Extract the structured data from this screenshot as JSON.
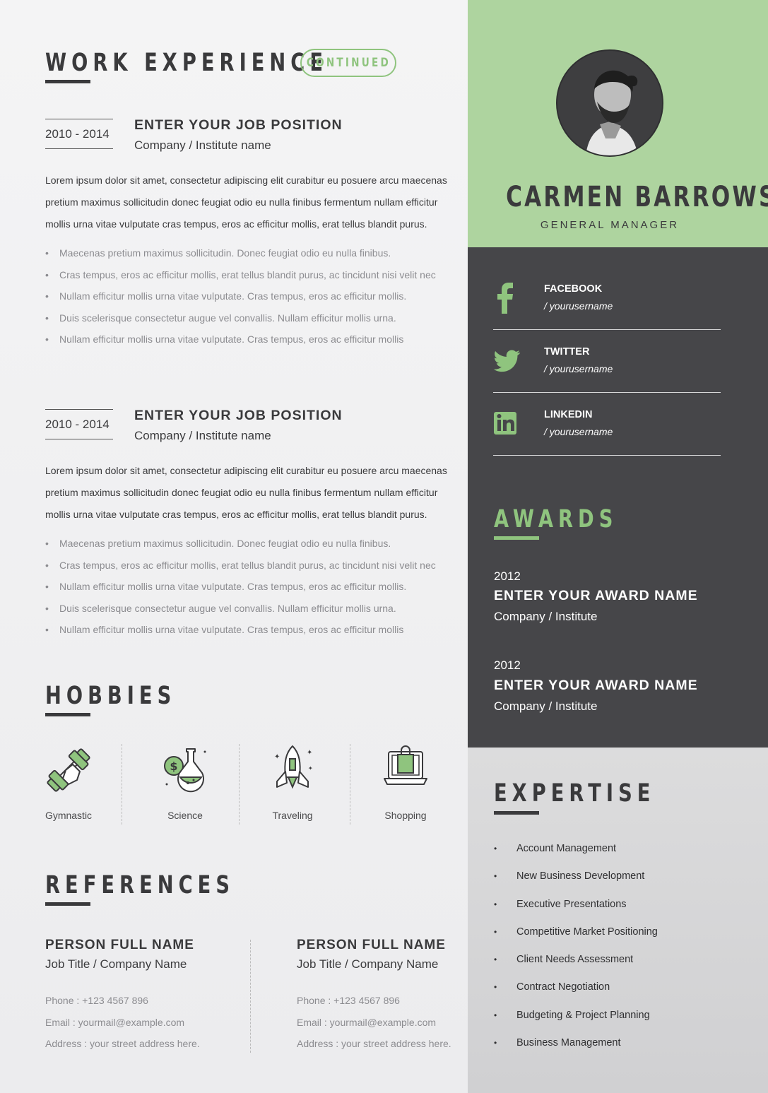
{
  "colors": {
    "accent": "#aed49f",
    "accent_text": "#8fc47e",
    "dark": "#464649",
    "light_panel": "#d6d6d8",
    "text": "#3a3a3c",
    "muted": "#8c8c90"
  },
  "work": {
    "title": "WORK EXPERIENCE",
    "badge": "CONTINUED",
    "jobs": [
      {
        "years": "2010 - 2014",
        "position": "ENTER YOUR JOB POSITION",
        "company": "Company / Institute name",
        "description": "Lorem ipsum dolor sit amet, consectetur adipiscing elit curabitur eu posuere arcu maecenas pretium maximus sollicitudin donec feugiat odio eu nulla finibus fermentum nullam efficitur mollis urna vitae vulputate cras tempus, eros ac efficitur mollis, erat tellus blandit purus.",
        "bullets": [
          "Maecenas pretium maximus sollicitudin. Donec feugiat odio eu nulla finibus.",
          "Cras tempus, eros ac efficitur mollis, erat tellus blandit purus, ac tincidunt nisi velit nec",
          "Nullam efficitur mollis urna vitae vulputate. Cras tempus, eros ac efficitur mollis.",
          "Duis scelerisque consectetur augue vel convallis.  Nullam efficitur mollis urna.",
          "Nullam efficitur mollis urna vitae vulputate. Cras tempus, eros ac efficitur mollis"
        ]
      },
      {
        "years": "2010 - 2014",
        "position": "ENTER YOUR JOB POSITION",
        "company": "Company / Institute name",
        "description": "Lorem ipsum dolor sit amet, consectetur adipiscing elit curabitur eu posuere arcu maecenas pretium maximus sollicitudin donec feugiat odio eu nulla finibus fermentum nullam efficitur mollis urna vitae vulputate cras tempus, eros ac efficitur mollis, erat tellus blandit purus.",
        "bullets": [
          "Maecenas pretium maximus sollicitudin. Donec feugiat odio eu nulla finibus.",
          "Cras tempus, eros ac efficitur mollis, erat tellus blandit purus, ac tincidunt nisi velit nec",
          "Nullam efficitur mollis urna vitae vulputate. Cras tempus, eros ac efficitur mollis.",
          "Duis scelerisque consectetur augue vel convallis.  Nullam efficitur mollis urna.",
          "Nullam efficitur mollis urna vitae vulputate. Cras tempus, eros ac efficitur mollis"
        ]
      }
    ]
  },
  "hobbies": {
    "title": "HOBBIES",
    "items": [
      {
        "label": "Gymnastic",
        "icon": "dumbbell-icon"
      },
      {
        "label": "Science",
        "icon": "flask-icon"
      },
      {
        "label": "Traveling",
        "icon": "rocket-icon"
      },
      {
        "label": "Shopping",
        "icon": "shopping-bag-icon"
      }
    ]
  },
  "references": {
    "title": "REFERENCES",
    "people": [
      {
        "name": "PERSON FULL NAME",
        "job": "Job Title / Company Name",
        "phone": "Phone  :  +123 4567 896",
        "email": "Email  :  yourmail@example.com",
        "address": "Address : your street address here."
      },
      {
        "name": "PERSON FULL NAME",
        "job": "Job Title / Company Name",
        "phone": "Phone  :  +123 4567 896",
        "email": "Email  :  yourmail@example.com",
        "address": "Address : your street address here."
      }
    ]
  },
  "profile": {
    "name": "CARMEN BARROWS",
    "role": "GENERAL MANAGER"
  },
  "social": [
    {
      "network": "FACEBOOK",
      "handle": "/ yourusername",
      "icon": "facebook-icon"
    },
    {
      "network": "TWITTER",
      "handle": "/ yourusername",
      "icon": "twitter-icon"
    },
    {
      "network": "LINKEDIN",
      "handle": "/ yourusername",
      "icon": "linkedin-icon"
    }
  ],
  "awards": {
    "title": "AWARDS",
    "items": [
      {
        "year": "2012",
        "name": "ENTER YOUR AWARD NAME",
        "company": "Company / Institute"
      },
      {
        "year": "2012",
        "name": "ENTER YOUR AWARD NAME",
        "company": "Company / Institute"
      }
    ]
  },
  "expertise": {
    "title": "EXPERTISE",
    "items": [
      "Account Management",
      "New Business Development",
      "Executive Presentations",
      "Competitive Market Positioning",
      "Client Needs Assessment",
      "Contract Negotiation",
      "Budgeting & Project Planning",
      "Business Management"
    ]
  }
}
